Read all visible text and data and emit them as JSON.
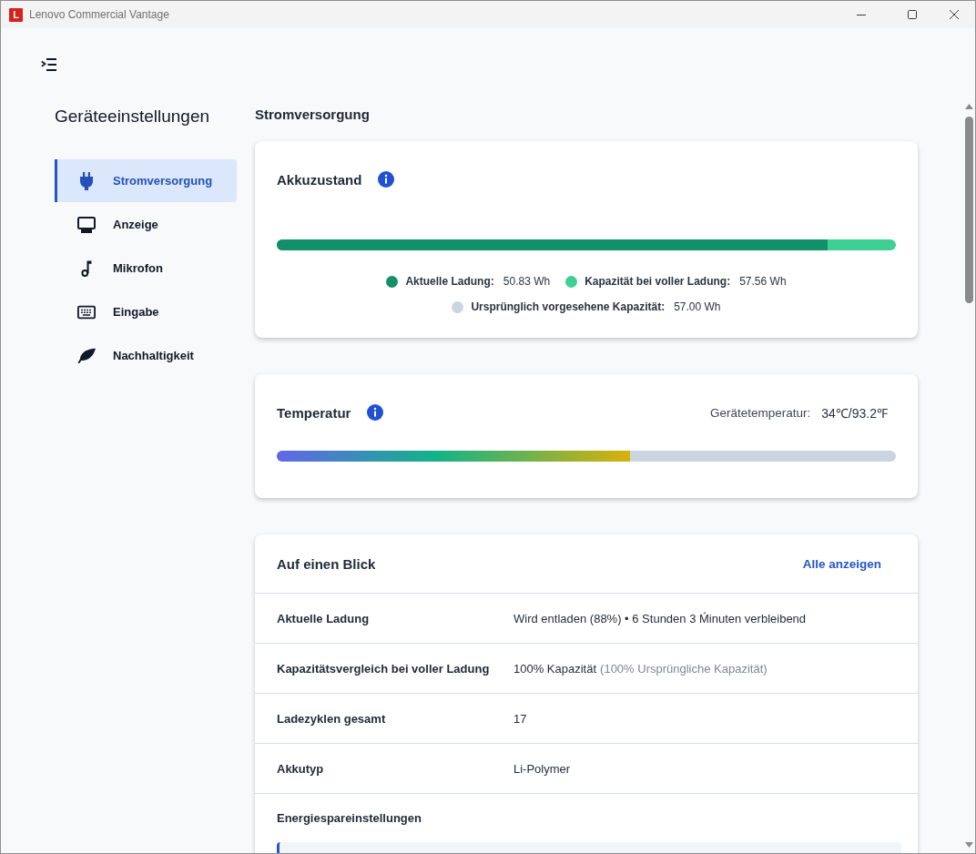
{
  "window": {
    "logo_letter": "L",
    "title": "Lenovo Commercial Vantage"
  },
  "sidebar": {
    "title": "Geräteeinstellungen",
    "items": [
      {
        "label": "Stromversorgung",
        "selected": true
      },
      {
        "label": "Anzeige",
        "selected": false
      },
      {
        "label": "Mikrofon",
        "selected": false
      },
      {
        "label": "Eingabe",
        "selected": false
      },
      {
        "label": "Nachhaltigkeit",
        "selected": false
      }
    ]
  },
  "page": {
    "heading": "Stromversorgung"
  },
  "battery_health": {
    "title": "Akkuzustand",
    "level": 0.89,
    "legend": [
      {
        "label": "Aktuelle Ladung:",
        "value": "50.83 Wh",
        "color": "#12906a"
      },
      {
        "label": "Kapazität bei voller Ladung:",
        "value": "57.56 Wh",
        "color": "#3ecf95"
      },
      {
        "label": "Ursprünglich vorgesehene Kapazität:",
        "value": "57.00 Wh",
        "color": "#cbd5e1"
      }
    ]
  },
  "temperature": {
    "title": "Temperatur",
    "reading_label": "Gerätetemperatur:",
    "reading": "34℃/93.2℉",
    "level": 0.57
  },
  "at_a_glance": {
    "title": "Auf einen Blick",
    "link": "Alle anzeigen",
    "rows": [
      {
        "label": "Aktuelle Ladung",
        "value": "Wird entladen (88%) • 6 Stunden 3 Ḿinuten verbleibend"
      },
      {
        "label": "Kapazitätsvergleich bei voller Ladung",
        "value": "100% Kapazität",
        "note": "(100% Ursprüngliche Kapazität)"
      },
      {
        "label": "Ladezyklen gesamt",
        "value": "17"
      },
      {
        "label": "Akkutyp",
        "value": "Li-Polymer"
      }
    ],
    "section": "Energiespareinstellungen"
  }
}
